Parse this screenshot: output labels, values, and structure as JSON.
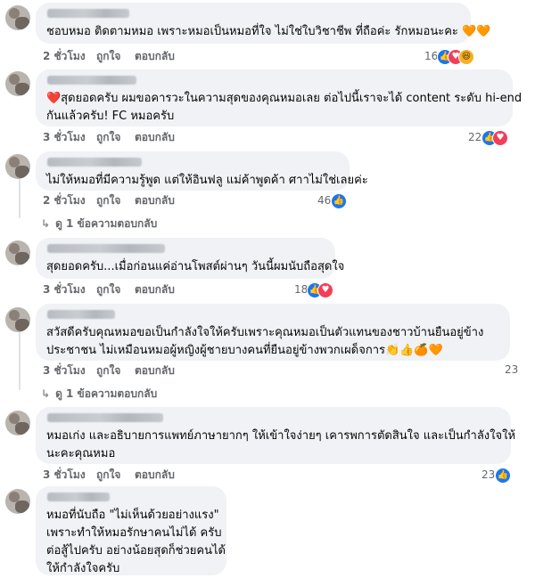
{
  "comments": [
    {
      "text_lines": [
        "ชอบหมอ ติดตามหมอ เพราะหมอเป็นหมอที่ใจ ไม่ใช่ใบวิชาชีพ ที่ถือค่ะ รักหมอนะคะ 🧡🧡"
      ],
      "time": "2 ชั่วโมง",
      "like": "ถูกใจ",
      "reply": "ตอบกลับ",
      "reaction_count": "16",
      "reactions": [
        "like-icon",
        "love-icon",
        "haha-icon"
      ]
    },
    {
      "text_lines": [
        "❤️สุดยอดครับ ผมขอคารวะในความสุดของคุณหมอเลย ต่อไปนี้เราจะได้ content ระดับ hi-end",
        "กันแล้วครับ! FC หมอครับ"
      ],
      "time": "3 ชั่วโมง",
      "like": "ถูกใจ",
      "reply": "ตอบกลับ",
      "reaction_count": "22",
      "reactions": [
        "like-icon",
        "love-icon"
      ]
    },
    {
      "text_lines": [
        "ไม่ให้หมอที่มีความรู้พูด แต่ให้อินฟลู แม่ค้าพูดค้า ศาาไม่ใช่เลยค่ะ"
      ],
      "time": "2 ชั่วโมง",
      "like": "ถูกใจ",
      "reply": "ตอบกลับ",
      "reaction_count": "46",
      "reactions": [
        "like-icon"
      ],
      "replies_label": "ดู 1 ข้อความตอบกลับ"
    },
    {
      "text_lines": [
        "สุดยอดครับ...เมื่อก่อนแค่อ่านโพสต์ผ่านๆ วันนี้ผมนับถือสุดใจ"
      ],
      "time": "3 ชั่วโมง",
      "like": "ถูกใจ",
      "reply": "ตอบกลับ",
      "reaction_count": "18",
      "reactions": [
        "like-icon",
        "love-icon"
      ]
    },
    {
      "text_lines": [
        "สวัสดีครับคุณหมอขอเป็นกำลังใจให้ครับเพราะคุณหมอเป็นตัวแทนของชาวบ้านยืนอยู่ข้าง",
        "ประชาชน ไม่เหมือนหมอผู้หญิงผู้ชายบางคนที่ยืนอยู่ข้างพวกเผด็จการ👏👍🍊🧡"
      ],
      "time": "3 ชั่วโมง",
      "like": "ถูกใจ",
      "reply": "ตอบกลับ",
      "reaction_count": "23",
      "reactions": [],
      "replies_label": "ดู 1 ข้อความตอบกลับ"
    },
    {
      "text_lines": [
        "หมอเก่ง และอธิบายการแพทย์ภาษายากๆ ให้เข้าใจง่ายๆ เคารพการตัดสินใจ และเป็นกำลังใจให้",
        "นะคะคุณหมอ"
      ],
      "time": "3 ชั่วโมง",
      "like": "ถูกใจ",
      "reply": "ตอบกลับ",
      "reaction_count": "23",
      "reactions": [
        "like-icon"
      ]
    },
    {
      "text_lines": [
        "หมอที่นับถือ \"ไม่เห็นด้วยอย่างแรง\"",
        "เพราะทำให้หมอรักษาคนไม่ได้ ครับ",
        "ต่อสู้ไปครับ อย่างน้อยสุดก็ช่วยคนได้",
        "ให้กำลังใจครับ"
      ],
      "time": "",
      "like": "",
      "reply": "",
      "reaction_count": "",
      "reactions": []
    }
  ]
}
